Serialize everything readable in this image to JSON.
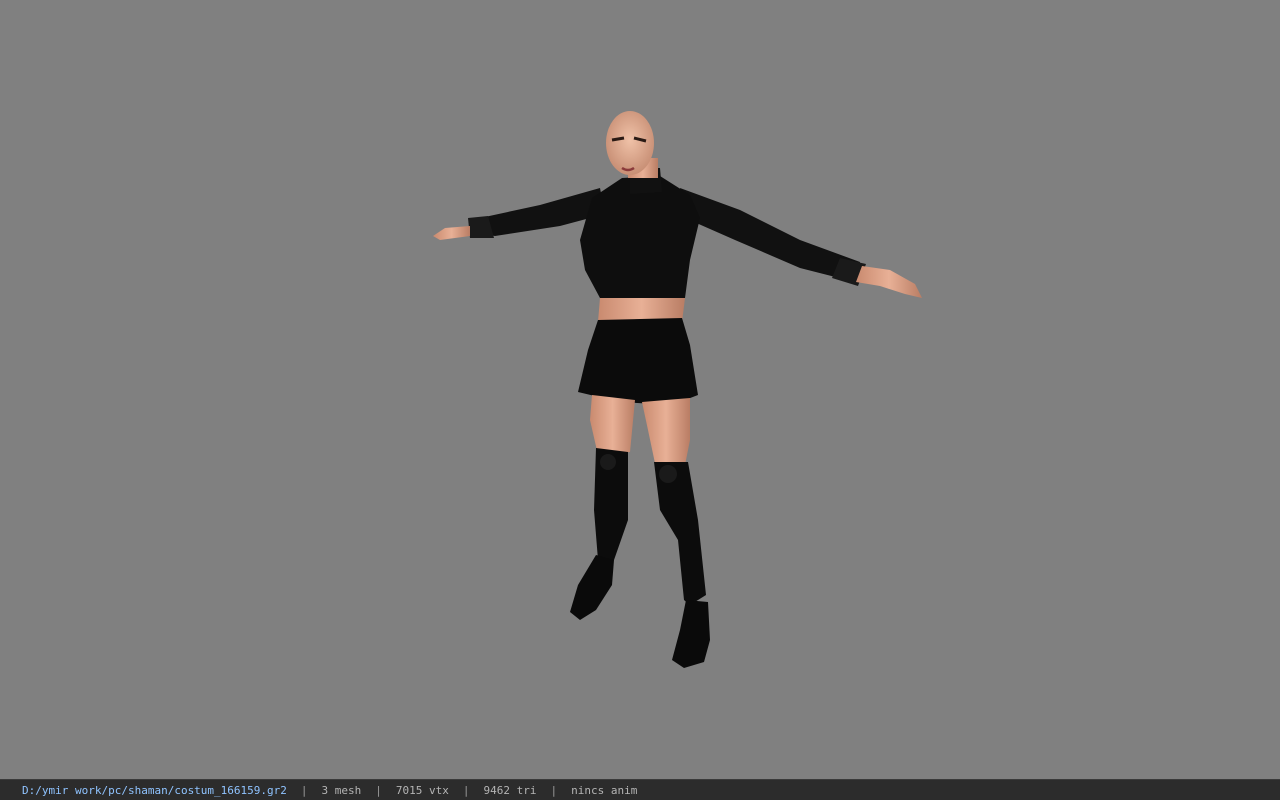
{
  "viewport": {
    "background_color": "#808080",
    "model": {
      "description_icon": "character-model",
      "outfit_color": "#0d0d0d",
      "skin_color": "#e0a484"
    }
  },
  "status_bar": {
    "file_path": "D:/ymir work/pc/shaman/costum_166159.gr2",
    "separator": "|",
    "mesh_count": "3 mesh",
    "vertex_count": "7015 vtx",
    "triangle_count": "9462 tri",
    "animation_status": "nincs anim",
    "path_color": "#8fc3ff"
  }
}
